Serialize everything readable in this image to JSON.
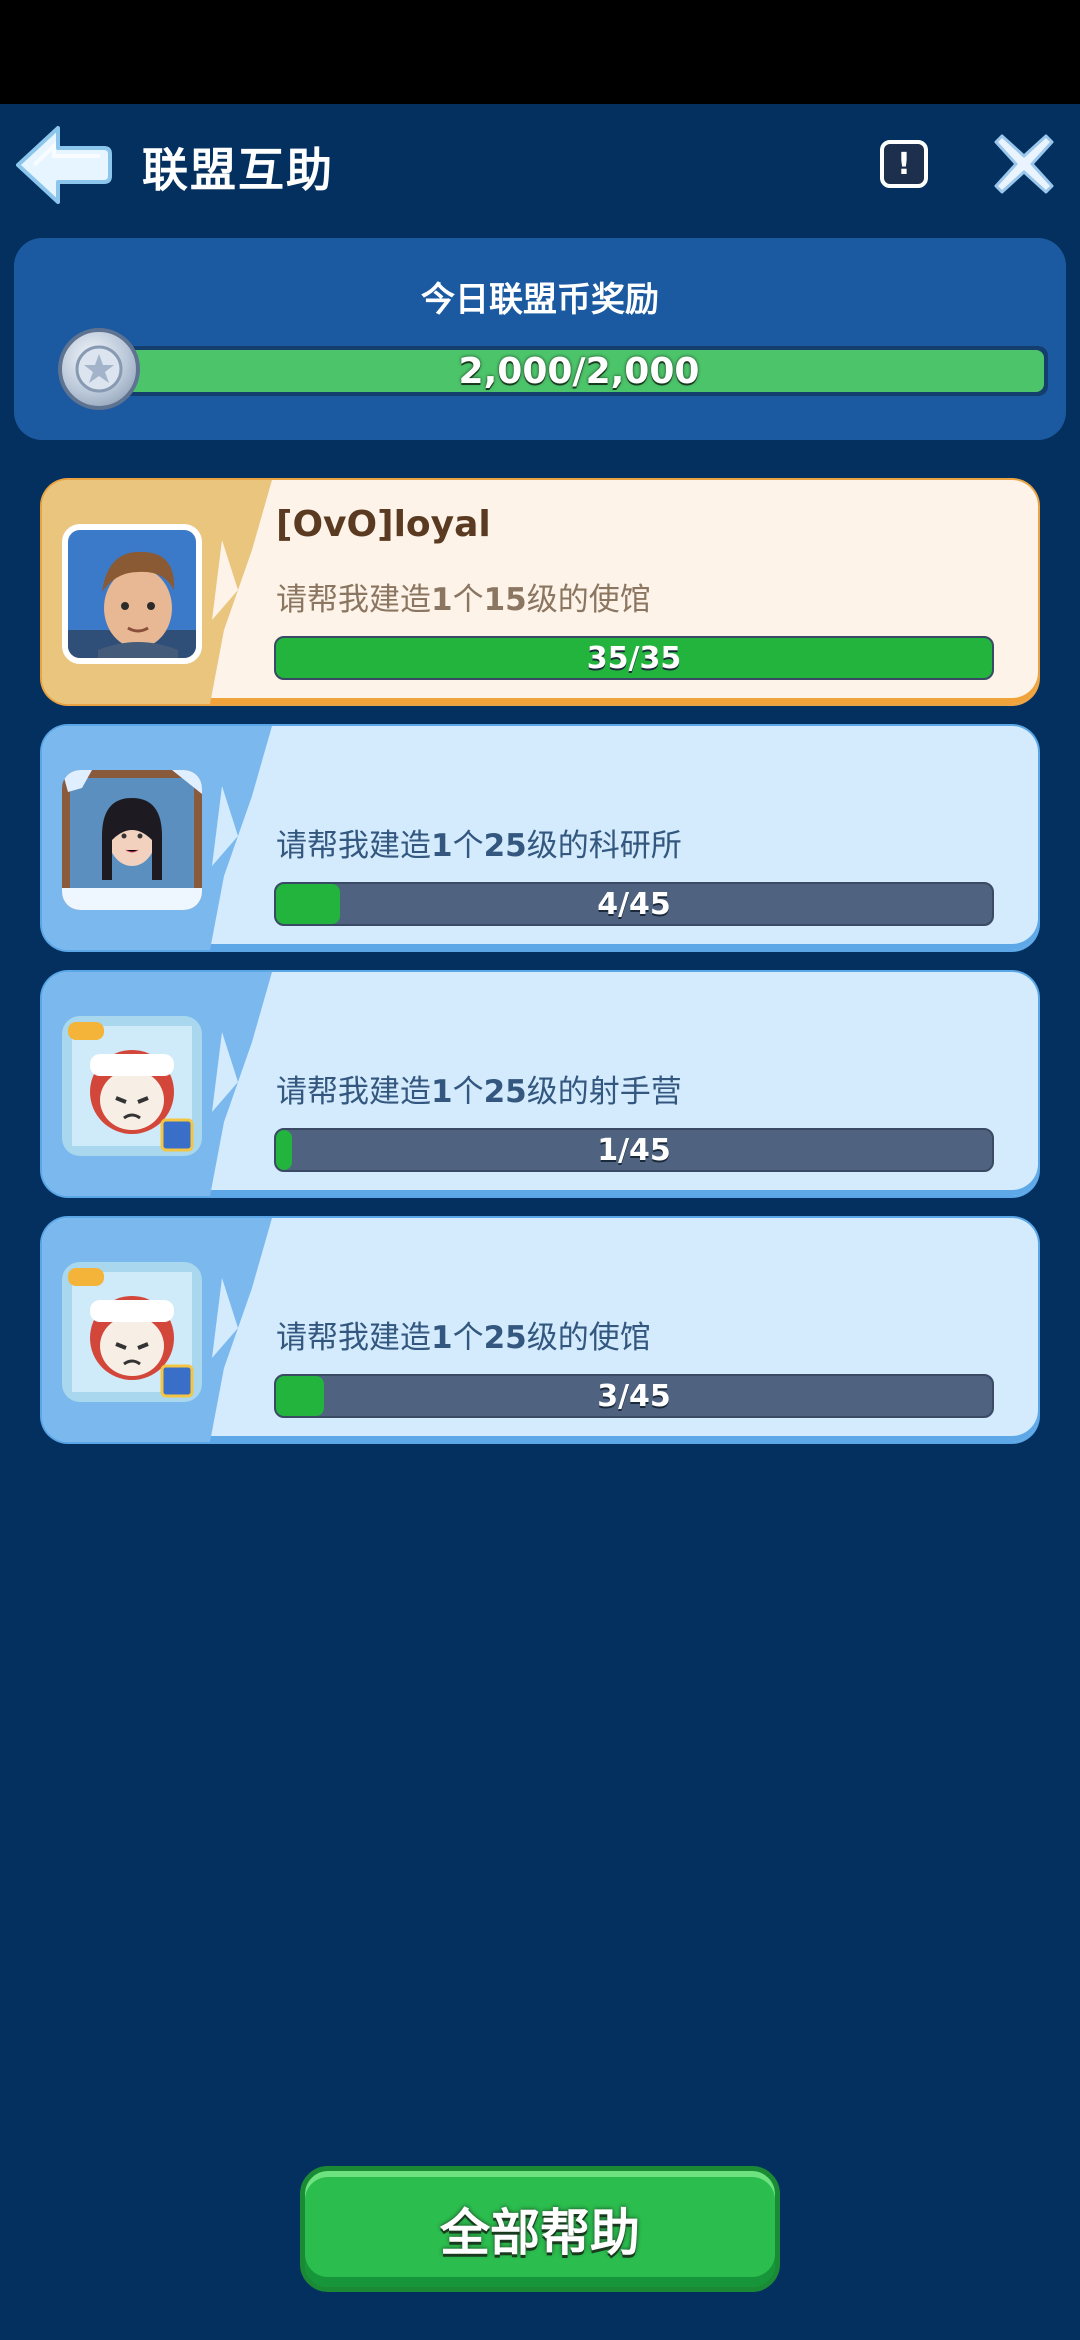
{
  "header": {
    "title": "联盟互助",
    "info_symbol": "!"
  },
  "reward": {
    "title": "今日联盟币奖励",
    "progress_text": "2,000/2,000",
    "progress_fraction": 1.0
  },
  "requests": [
    {
      "name": "[OvO]loyal",
      "desc_prefix": "请帮我建造",
      "count": "1",
      "count_unit": "个",
      "level": "15",
      "level_unit": "级的",
      "building": "使馆",
      "progress_text": "35/35",
      "progress_fraction": 1.0,
      "style": "gold"
    },
    {
      "name": "",
      "desc_prefix": "请帮我建造",
      "count": "1",
      "count_unit": "个",
      "level": "25",
      "level_unit": "级的",
      "building": "科研所",
      "progress_text": "4/45",
      "progress_fraction": 0.089,
      "style": "blue"
    },
    {
      "name": "",
      "desc_prefix": "请帮我建造",
      "count": "1",
      "count_unit": "个",
      "level": "25",
      "level_unit": "级的",
      "building": "射手营",
      "progress_text": "1/45",
      "progress_fraction": 0.022,
      "style": "blue"
    },
    {
      "name": "",
      "desc_prefix": "请帮我建造",
      "count": "1",
      "count_unit": "个",
      "level": "25",
      "level_unit": "级的",
      "building": "使馆",
      "progress_text": "3/45",
      "progress_fraction": 0.067,
      "style": "blue"
    }
  ],
  "footer": {
    "help_all_label": "全部帮助"
  },
  "colors": {
    "background": "#03305f",
    "panel": "#1b5aa0",
    "progress_green": "#22b43c",
    "button_green": "#2bbd4e"
  }
}
